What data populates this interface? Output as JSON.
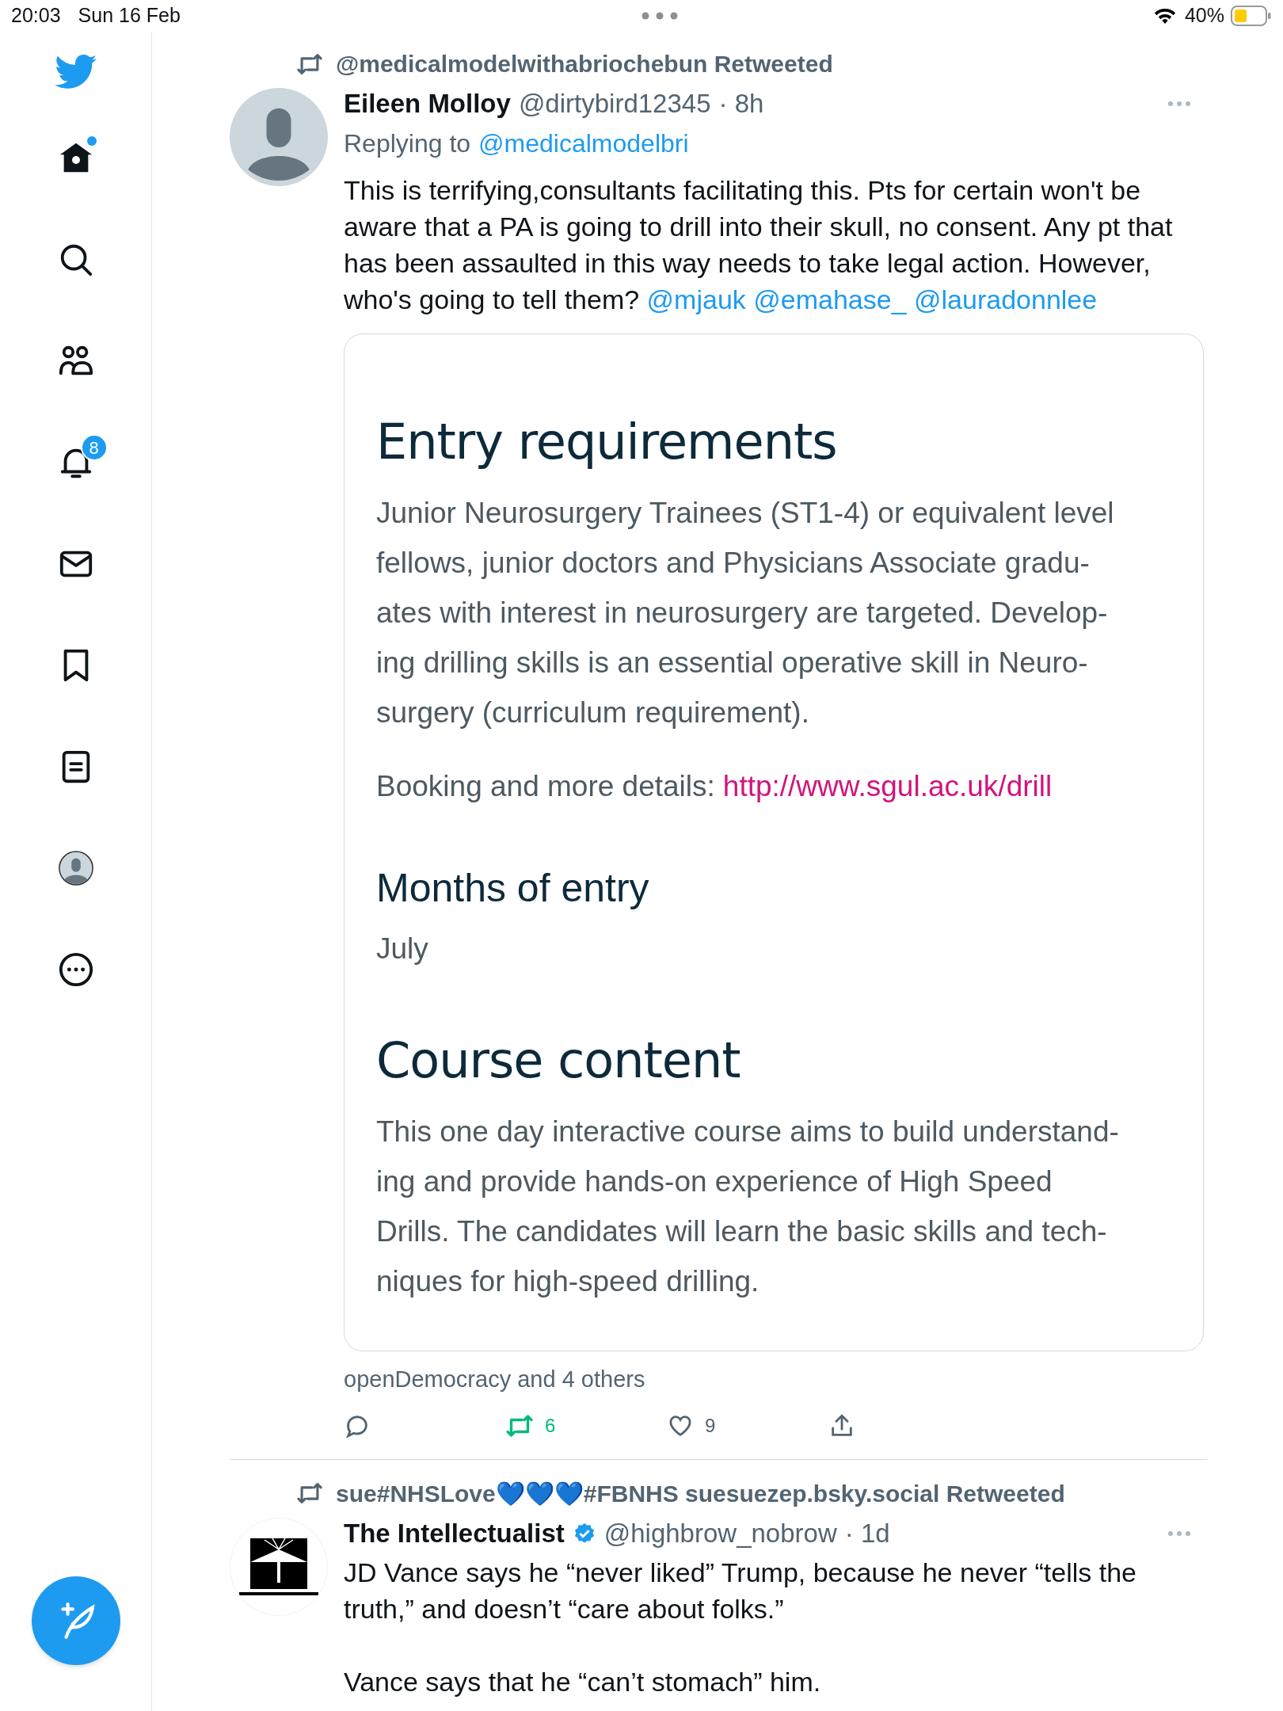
{
  "status_bar": {
    "time": "20:03",
    "date": "Sun 16 Feb",
    "battery": "40%"
  },
  "sidebar": {
    "items": [
      {
        "kind": "home",
        "dot": true
      },
      {
        "kind": "search"
      },
      {
        "kind": "communities"
      },
      {
        "kind": "notifications",
        "badge": "8"
      },
      {
        "kind": "messages"
      },
      {
        "kind": "bookmarks"
      },
      {
        "kind": "lists"
      },
      {
        "kind": "profile"
      },
      {
        "kind": "more"
      }
    ]
  },
  "tweets": [
    {
      "retweeted_by": "@medicalmodelwithabriochebun Retweeted",
      "avatar": {
        "kind": "default"
      },
      "name": "Eileen Molloy",
      "verified": false,
      "handle": "@dirtybird12345",
      "time": "· 8h",
      "replying_label": "Replying to",
      "replying_to": "@medicalmodelbri",
      "text": "This is terrifying,consultants facilitating this. Pts for certain won't be aware that a PA is going to drill into their skull, no consent. Any pt that has been assaulted in this way needs to take legal action. However, who's going to tell them?",
      "mentions": [
        "@mjauk",
        "@emahase_",
        "@lauradonnlee"
      ],
      "card": {
        "blocks": [
          {
            "kind": "heading",
            "text": "Entry requirements"
          },
          {
            "kind": "body",
            "lines": [
              "Junior Neurosurgery Trainees (ST1-4) or equivalent level",
              "fellows, junior doctors and Physicians Associate gradu-",
              "ates with interest in neurosurgery are targeted. Develop-",
              "ing drilling skills is an essential operative skill in Neuro-",
              "surgery (curriculum requirement)."
            ]
          },
          {
            "kind": "link_line",
            "label": "Booking and more details:",
            "url": "http://www.sgul.ac.uk/drill"
          },
          {
            "kind": "subheading",
            "text": "Months of entry"
          },
          {
            "kind": "body",
            "lines": [
              "July"
            ]
          },
          {
            "kind": "heading",
            "text": "Course content"
          },
          {
            "kind": "body",
            "lines": [
              "This one day interactive course aims to build understand-",
              "ing and provide hands-on experience of High Speed",
              "Drills. The candidates will learn the basic skills and tech-",
              "niques for high-speed drilling."
            ]
          }
        ]
      },
      "social_context": "openDemocracy and 4 others",
      "actions": {
        "retweets": "6",
        "retweeted": true,
        "likes": "9",
        "liked": false
      }
    },
    {
      "retweeted_by": "sue#NHSLove💙💙💙#FBNHS suesuezep.bsky.social Retweeted",
      "avatar": {
        "kind": "logo"
      },
      "name": "The Intellectualist",
      "verified": true,
      "handle": "@highbrow_nobrow",
      "time": "· 1d",
      "paragraphs": [
        "JD Vance says he “never liked” Trump, because he never “tells the truth,” and doesn’t “care about folks.”",
        "Vance says that he “can’t stomach” him."
      ]
    }
  ]
}
